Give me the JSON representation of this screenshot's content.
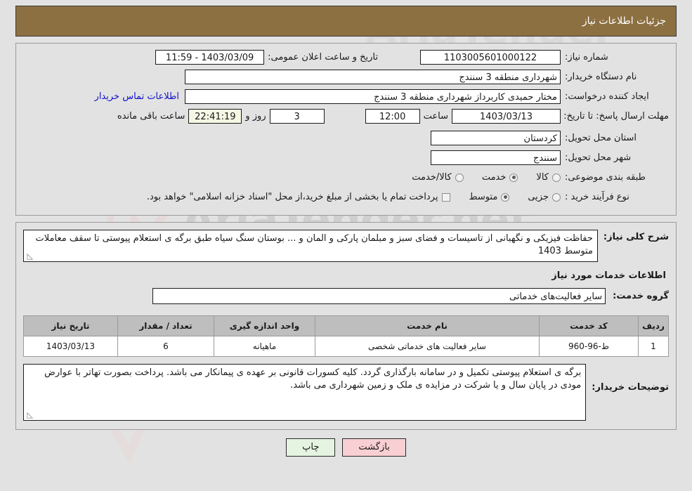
{
  "header": {
    "title": "جزئیات اطلاعات نیاز"
  },
  "watermark": {
    "brand": "AriaTender.net",
    "brand_upper": "AriaTender"
  },
  "form": {
    "need_number_label": "شماره نیاز:",
    "need_number_value": "1103005601000122",
    "announce_datetime_label": "تاریخ و ساعت اعلان عمومی:",
    "announce_datetime_value": "1403/03/09 - 11:59",
    "buyer_org_label": "نام دستگاه خریدار:",
    "buyer_org_value": "شهرداری منطقه 3 سنندج",
    "creator_label": "ایجاد کننده درخواست:",
    "creator_value": "مختار حمیدی کاربرداز شهرداری منطقه 3 سنندج",
    "contact_link": "اطلاعات تماس خریدار",
    "deadline_label": "مهلت ارسال پاسخ: تا تاریخ:",
    "deadline_date": "1403/03/13",
    "hour_label": "ساعت",
    "deadline_time": "12:00",
    "days_value": "3",
    "days_label": "روز و",
    "timer_value": "22:41:19",
    "remaining_label": "ساعت باقی مانده",
    "province_label": "استان محل تحویل:",
    "province_value": "کردستان",
    "city_label": "شهر محل تحویل:",
    "city_value": "سنندج",
    "category_label": "طبقه بندی موضوعی:",
    "category_options": [
      {
        "label": "کالا",
        "selected": false
      },
      {
        "label": "خدمت",
        "selected": true
      },
      {
        "label": "کالا/خدمت",
        "selected": false
      }
    ],
    "process_label": "نوع فرآیند خرید :",
    "process_options": [
      {
        "label": "جزیی",
        "selected": false
      },
      {
        "label": "متوسط",
        "selected": true
      }
    ],
    "treasury_checkbox_checked": false,
    "treasury_note": "پرداخت تمام یا بخشی از مبلغ خرید،از محل \"اسناد خزانه اسلامی\" خواهد بود."
  },
  "details": {
    "summary_label": "شرح کلی نیاز:",
    "summary_value": "حفاظت فیزیکی و نگهبانی از تاسیسات و فضای سبز و مبلمان پارکی و المان و ... بوستان سنگ سیاه طبق برگه ی استعلام پیوستی تا سقف معاملات متوسط 1403",
    "services_section_title": "اطلاعات خدمات مورد نیاز",
    "service_group_label": "گروه خدمت:",
    "service_group_value": "سایر فعالیت‌های خدماتی",
    "table": {
      "headers": [
        "ردیف",
        "کد خدمت",
        "نام خدمت",
        "واحد اندازه گیری",
        "تعداد / مقدار",
        "تاریخ نیاز"
      ],
      "rows": [
        {
          "row": "1",
          "code": "ط-96-960",
          "name": "سایر فعالیت های خدماتی شخصی",
          "unit": "ماهیانه",
          "qty": "6",
          "date": "1403/03/13"
        }
      ]
    },
    "buyer_notes_label": "توضیحات خریدار:",
    "buyer_notes_value": "برگه ی استعلام پیوستی تکمیل و در سامانه بارگذاری گردد. کلیه کسورات قانونی بر عهده ی پیمانکار می باشد. پرداخت بصورت تهاتر با عوارض مودی در  پایان سال و یا شرکت در مزایده ی ملک و زمین شهرداری می باشد."
  },
  "footer": {
    "back_label": "بازگشت",
    "print_label": "چاپ"
  }
}
